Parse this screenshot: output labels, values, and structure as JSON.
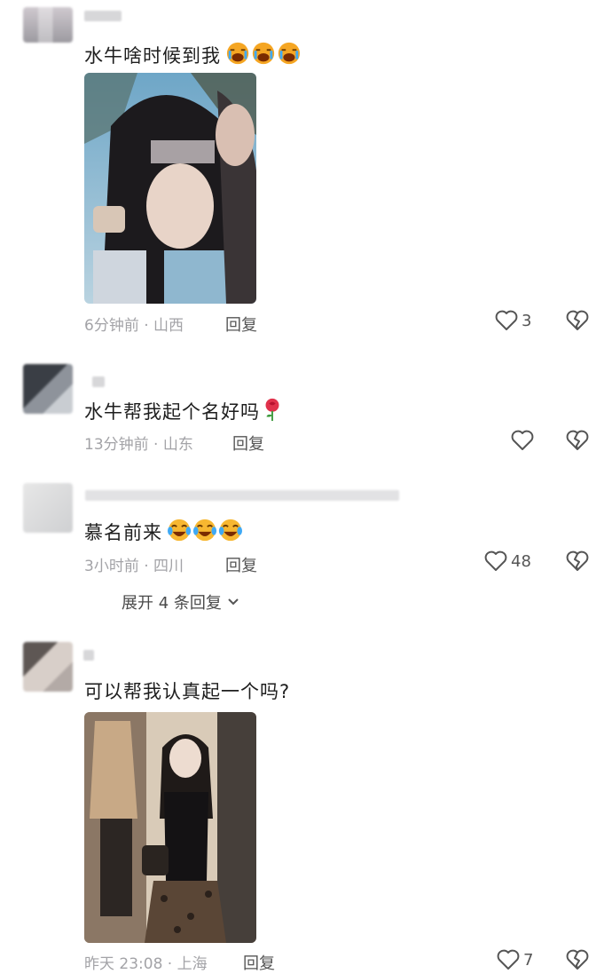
{
  "comments": [
    {
      "text": "水牛啥时候到我",
      "emoji": "😭😭😭",
      "time": "6分钟前 · 山西",
      "reply_label": "回复",
      "likes": "3"
    },
    {
      "text": "水牛帮我起个名好吗",
      "emoji": "🌹",
      "time": "13分钟前 · 山东",
      "reply_label": "回复",
      "likes": ""
    },
    {
      "text": "慕名前来",
      "emoji": "😂😂😂",
      "time": "3小时前 · 四川",
      "reply_label": "回复",
      "likes": "48",
      "expand_label": "展开 4 条回复"
    },
    {
      "text": "可以帮我认真起一个吗?",
      "time": "昨天 23:08 · 上海",
      "reply_label": "回复",
      "likes": "7"
    }
  ],
  "icons": [
    "heart-outline-icon",
    "broken-heart-icon",
    "chevron-down-icon",
    "crying-face-emoji",
    "tears-of-joy-emoji",
    "rose-emoji"
  ],
  "colors": {
    "text": "#1e1e1e",
    "meta": "#a3a3a7",
    "icon": "#555555"
  }
}
